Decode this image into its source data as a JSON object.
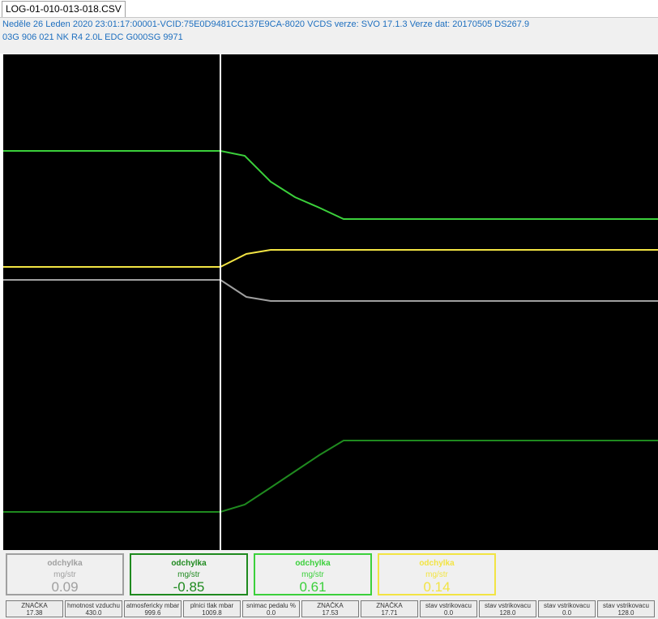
{
  "tab": {
    "label": "LOG-01-010-013-018.CSV"
  },
  "header": {
    "line1": "Neděle 26 Leden 2020 23:01:17:00001-VCID:75E0D9481CC137E9CA-8020 VCDS verze: SVO 17.1.3 Verze dat: 20170505 DS267.9",
    "line2": "03G 906 021 NK  R4 2.0L EDC G000SG  9971"
  },
  "colors": {
    "background": "#000000",
    "cursor": "#ffffff",
    "gray": "#a0a0a0",
    "darkgreen": "#1f8a1f",
    "green": "#3bd03b",
    "yellow": "#f2e443"
  },
  "gauges": [
    {
      "label": "odchylka",
      "unit": "mg/str",
      "value": "0.09",
      "color": "#a0a0a0"
    },
    {
      "label": "odchylka",
      "unit": "mg/str",
      "value": "-0.85",
      "color": "#1f8a1f"
    },
    {
      "label": "odchylka",
      "unit": "mg/str",
      "value": "0.61",
      "color": "#3bd03b"
    },
    {
      "label": "odchylka",
      "unit": "mg/str",
      "value": "0.14",
      "color": "#f2e443"
    }
  ],
  "cells": [
    {
      "name": "ZNAČKA",
      "value": "17.38"
    },
    {
      "name": "hmotnost vzduchu",
      "value": "430.0"
    },
    {
      "name": "atmosfericky mbar",
      "value": "999.6"
    },
    {
      "name": "plnici tlak mbar",
      "value": "1009.8"
    },
    {
      "name": "snimac pedalu %",
      "value": "0.0"
    },
    {
      "name": "ZNAČKA",
      "value": "17.53"
    },
    {
      "name": "ZNAČKA",
      "value": "17.71"
    },
    {
      "name": "stav vstrikovacu",
      "value": "0.0"
    },
    {
      "name": "stav vstrikovacu",
      "value": "128.0"
    },
    {
      "name": "stav vstrikovacu",
      "value": "0.0"
    },
    {
      "name": "stav vstrikovacu",
      "value": "128.0"
    }
  ]
}
